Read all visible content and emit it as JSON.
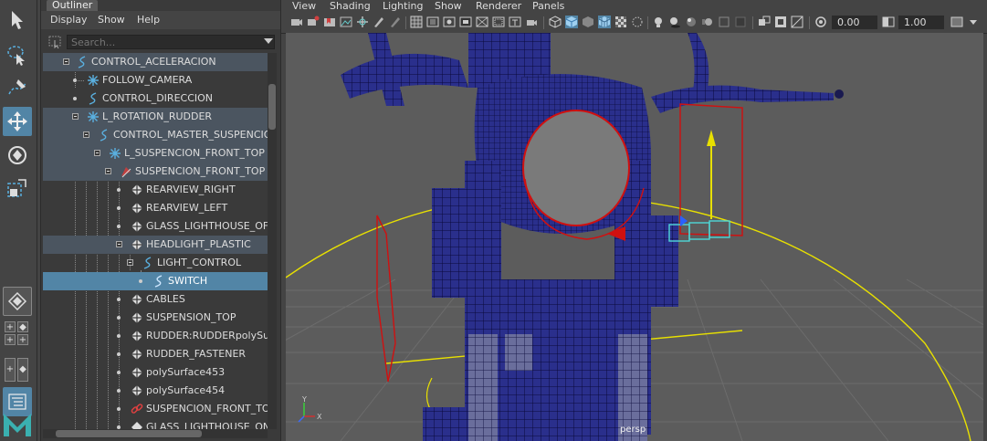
{
  "outliner": {
    "tab": "Outliner",
    "menu": [
      "Display",
      "Show",
      "Help"
    ],
    "search_placeholder": "Search...",
    "items": [
      {
        "label": "CONTROL_ACELERACION"
      },
      {
        "label": "FOLLOW_CAMERA"
      },
      {
        "label": "CONTROL_DIRECCION"
      },
      {
        "label": "L_ROTATION_RUDDER"
      },
      {
        "label": "CONTROL_MASTER_SUSPENCION"
      },
      {
        "label": "L_SUSPENCION_FRONT_TOP"
      },
      {
        "label": "SUSPENCION_FRONT_TOP"
      },
      {
        "label": "REARVIEW_RIGHT"
      },
      {
        "label": "REARVIEW_LEFT"
      },
      {
        "label": "GLASS_LIGHTHOUSE_OF"
      },
      {
        "label": "HEADLIGHT_PLASTIC"
      },
      {
        "label": "LIGHT_CONTROL"
      },
      {
        "label": "SWITCH"
      },
      {
        "label": "CABLES"
      },
      {
        "label": "SUSPENSION_TOP"
      },
      {
        "label": "RUDDER:RUDDERpolySur"
      },
      {
        "label": "RUDDER_FASTENER"
      },
      {
        "label": "polySurface453"
      },
      {
        "label": "polySurface454"
      },
      {
        "label": "SUSPENCION_FRONT_TOI"
      },
      {
        "label": "GLASS_LIGHTHOUSE_ON"
      }
    ]
  },
  "viewport": {
    "menu": [
      "View",
      "Shading",
      "Lighting",
      "Show",
      "Renderer",
      "Panels"
    ],
    "field_a": "0.00",
    "field_b": "1.00",
    "camera_label": "persp",
    "axis_y": "Y",
    "axis_x": "X"
  },
  "colors": {
    "selection": "#5285a6",
    "highlight_row": "#4b5560",
    "mesh": "#2a2f8c",
    "wire": "#0a0a3a",
    "headlight_lens": "#7a7a7a",
    "selected_outline": "#d01010",
    "yellow_curve": "#e8e000",
    "cyan_handle": "#4fd8d8",
    "grid_bg": "#5c5c5c"
  },
  "icons": {
    "toolbox": [
      "select-arrow-icon",
      "lasso-icon",
      "paint-select-icon",
      "move-icon",
      "rotate-icon",
      "scale-icon",
      "layout-icon",
      "four-panel-icon",
      "two-panel-icon",
      "outliner-layout-icon",
      "maya-logo-icon"
    ]
  }
}
